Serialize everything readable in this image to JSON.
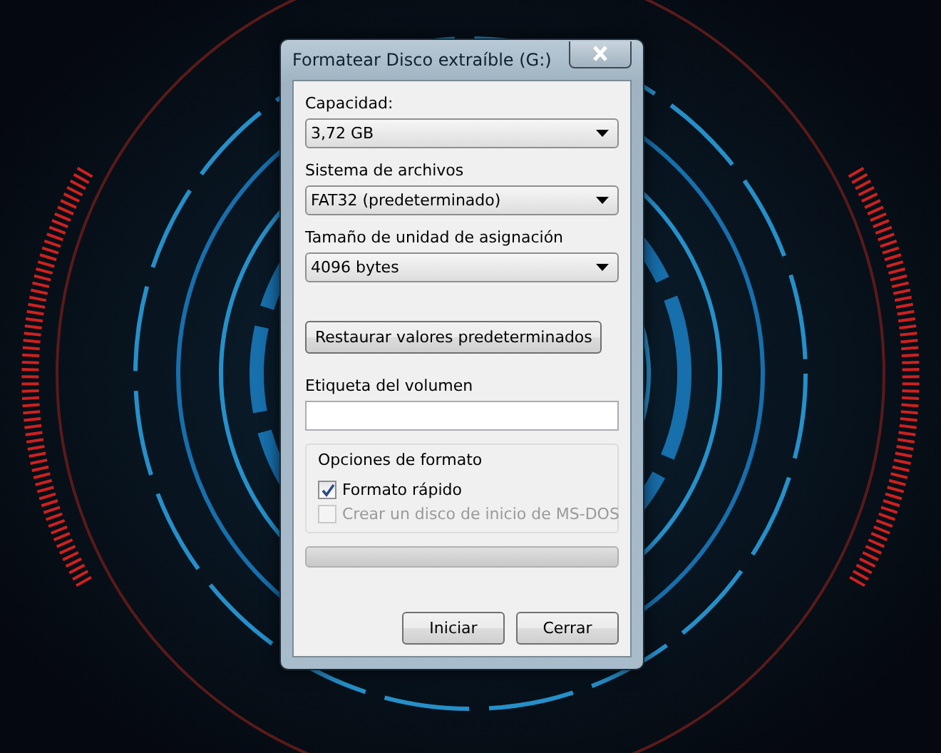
{
  "window": {
    "title": "Formatear Disco extraíble (G:)"
  },
  "dropdowns": [
    {
      "label": "Capacidad:",
      "value": "3,72 GB"
    },
    {
      "label": "Sistema de archivos",
      "value": "FAT32 (predeterminado)"
    },
    {
      "label": "Tamaño de unidad de asignación",
      "value": "4096 bytes"
    }
  ],
  "restore_button": "Restaurar valores predeterminados",
  "volume_label": {
    "label": "Etiqueta del volumen"
  },
  "format_options": {
    "title": "Opciones de formato",
    "options": [
      {
        "label": "Formato rápido",
        "checked": true,
        "disabled": false
      },
      {
        "label": "Crear un disco de inicio de MS-DOS",
        "checked": false,
        "disabled": true
      }
    ]
  },
  "progress": {
    "level": 0
  },
  "buttons": [
    "Iniciar",
    "Cerrar"
  ]
}
